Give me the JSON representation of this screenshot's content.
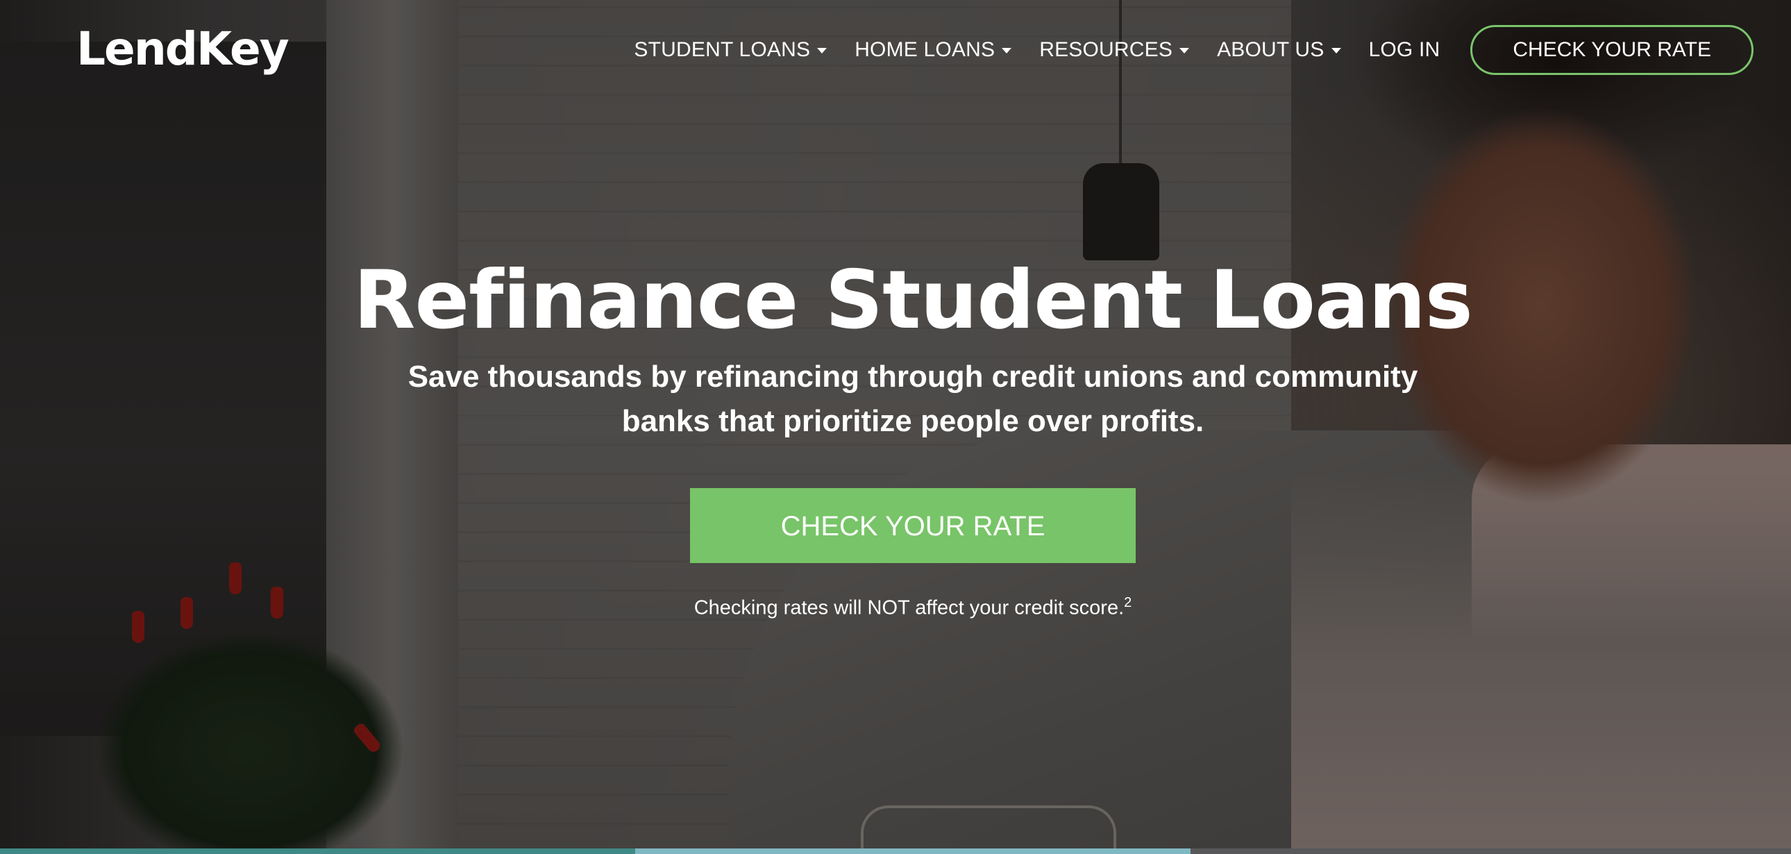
{
  "brand": {
    "logo_text": "LendKey",
    "accent_color": "#78c468"
  },
  "nav": {
    "items": [
      {
        "label": "STUDENT LOANS",
        "has_dropdown": true,
        "icon": "caret-down-icon"
      },
      {
        "label": "HOME LOANS",
        "has_dropdown": true,
        "icon": "caret-down-icon"
      },
      {
        "label": "RESOURCES",
        "has_dropdown": true,
        "icon": "caret-down-icon"
      },
      {
        "label": "ABOUT US",
        "has_dropdown": true,
        "icon": "caret-down-icon"
      },
      {
        "label": "LOG IN",
        "has_dropdown": false
      }
    ],
    "cta_label": "CHECK YOUR RATE"
  },
  "hero": {
    "title": "Refinance Student Loans",
    "subtitle": "Save thousands by refinancing through credit unions and community banks that prioritize people over profits.",
    "button_label": "CHECK YOUR RATE",
    "note": "Checking rates will NOT affect your credit score.",
    "note_footnote": "2"
  },
  "bottom_strip_colors": [
    "#3f8a86",
    "#7fb7c2",
    "#58585a"
  ]
}
